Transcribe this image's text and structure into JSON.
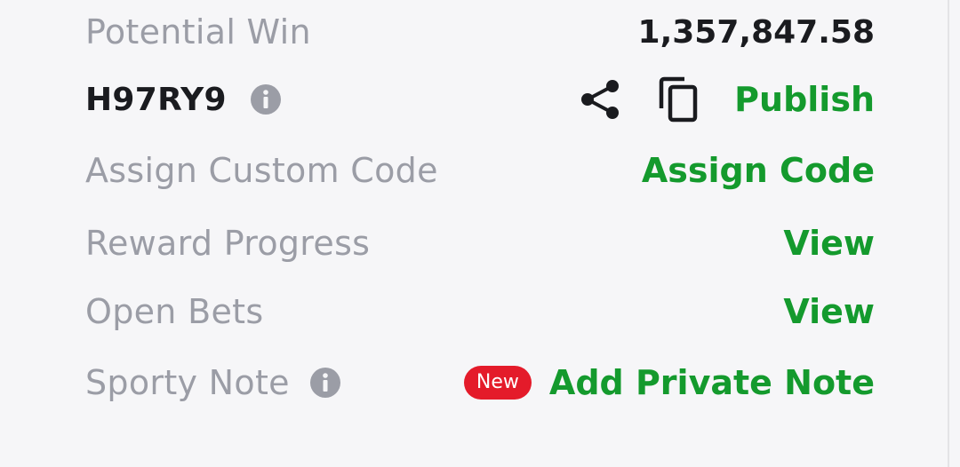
{
  "potential_win": {
    "label": "Potential Win",
    "value": "1,357,847.58"
  },
  "booking": {
    "code": "H97RY9",
    "info_icon": "info-icon",
    "share_icon": "share-icon",
    "copy_icon": "copy-icon",
    "publish_label": "Publish"
  },
  "custom_code": {
    "label": "Assign Custom Code",
    "action": "Assign Code"
  },
  "reward_progress": {
    "label": "Reward Progress",
    "action": "View"
  },
  "open_bets": {
    "label": "Open Bets",
    "action": "View"
  },
  "sporty_note": {
    "label": "Sporty Note",
    "info_icon": "info-icon",
    "badge": "New",
    "action": "Add Private Note"
  },
  "colors": {
    "accent_green": "#149a2d",
    "badge_red": "#e41b2a",
    "label_gray": "#9b9da6",
    "text_dark": "#1a1b1f",
    "background": "#f6f6f8"
  }
}
